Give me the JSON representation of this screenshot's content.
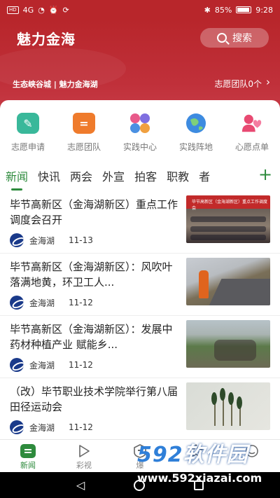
{
  "statusbar": {
    "left_chip": "HD",
    "signal": "4G",
    "right_bt": "✱",
    "battery_text": "85%",
    "time": "9:28"
  },
  "header": {
    "title": "魅力金海",
    "search_label": "搜索",
    "slogan": "生态峡谷城 | 魅力金海湖",
    "volunteer_text": "志愿团队0个",
    "colors": {
      "primary": "#b8262b"
    }
  },
  "quicknav": {
    "items": [
      {
        "label": "志愿申请",
        "icon": "pencil-card-icon",
        "color": "#39b89a"
      },
      {
        "label": "志愿团队",
        "icon": "house-team-icon",
        "color": "#ef7b2c"
      },
      {
        "label": "实践中心",
        "icon": "four-circles-icon",
        "color": "#7f6fe0"
      },
      {
        "label": "实践阵地",
        "icon": "globe-icon",
        "color": "#3d8be0"
      },
      {
        "label": "心愿点单",
        "icon": "heart-person-icon",
        "color": "#e84a72"
      }
    ]
  },
  "tabs": {
    "items": [
      "新闻",
      "快讯",
      "两会",
      "外宣",
      "拍客",
      "职教",
      "者"
    ],
    "active_index": 0,
    "add_label": "+"
  },
  "news": {
    "items": [
      {
        "title": "毕节高新区（金海湖新区）重点工作调度会召开",
        "source": "金海湖",
        "date": "11-13",
        "thumb_caption": "毕节高新区（金海湖新区）重点工作调度会"
      },
      {
        "title": "毕节高新区（金海湖新区）：风吹叶落满地黄，环卫工人...",
        "source": "金海湖",
        "date": "11-12"
      },
      {
        "title": "毕节高新区（金海湖新区）：发展中药材种植产业 赋能乡...",
        "source": "金海湖",
        "date": "11-12"
      },
      {
        "title": "（改）毕节职业技术学院举行第八届田径运动会",
        "source": "金海湖",
        "date": "11-12"
      }
    ]
  },
  "bottomnav": {
    "items": [
      {
        "label": "新闻",
        "icon": "news-icon",
        "active": true
      },
      {
        "label": "彩视",
        "icon": "play-icon",
        "active": false
      },
      {
        "label": "爆",
        "icon": "report-icon",
        "active": false
      },
      {
        "label": "",
        "icon": "star-icon",
        "active": false
      },
      {
        "label": "",
        "icon": "user-icon",
        "active": false
      }
    ]
  },
  "watermark": {
    "num": "592",
    "text": "软件园",
    "url": "www.592xiazai.com"
  }
}
